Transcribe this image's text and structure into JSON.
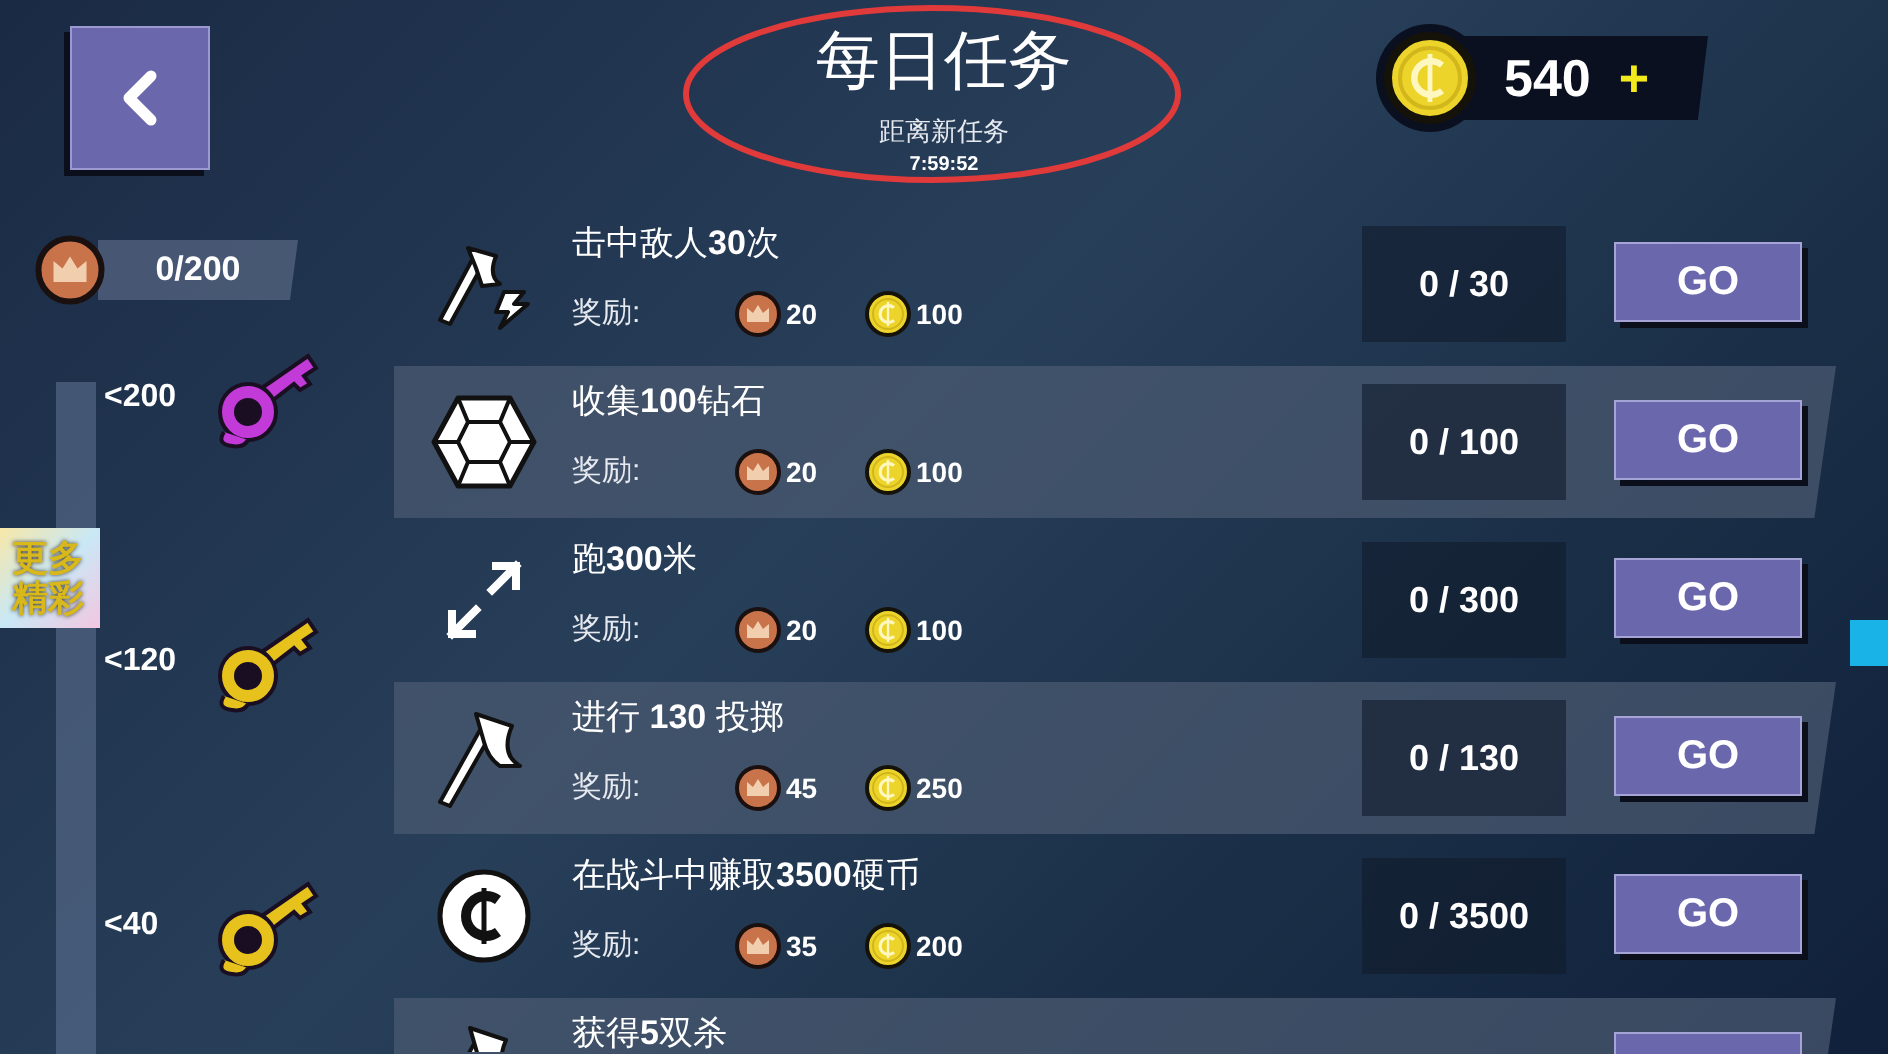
{
  "header": {
    "title": "每日任务",
    "subtitle": "距离新任务",
    "timer": "7:59:52"
  },
  "wallet": {
    "coins": "540",
    "add_label": "+"
  },
  "crown_progress": {
    "value": "0/200"
  },
  "milestones": [
    {
      "label": "<200",
      "color": "#c23ad8"
    },
    {
      "label": "<120",
      "color": "#e8c21c"
    },
    {
      "label": "<40",
      "color": "#e8c21c"
    }
  ],
  "promo_badge": {
    "text": "更多精彩"
  },
  "tasks": [
    {
      "kind": "hit",
      "title": "击中敌人**30**次",
      "reward_label": "奖励:",
      "crowns": "20",
      "coins": "100",
      "progress": "0 / 30",
      "button": "GO"
    },
    {
      "kind": "collect",
      "title": "收集**100**钻石",
      "reward_label": "奖励:",
      "crowns": "20",
      "coins": "100",
      "progress": "0 / 100",
      "button": "GO"
    },
    {
      "kind": "run",
      "title": "跑**300**米",
      "reward_label": "奖励:",
      "crowns": "20",
      "coins": "100",
      "progress": "0 / 300",
      "button": "GO"
    },
    {
      "kind": "throw",
      "title": "进行 **130** 投掷",
      "reward_label": "奖励:",
      "crowns": "45",
      "coins": "250",
      "progress": "0 / 130",
      "button": "GO"
    },
    {
      "kind": "earn",
      "title": "在战斗中赚取**3500**硬币",
      "reward_label": "奖励:",
      "crowns": "35",
      "coins": "200",
      "progress": "0 / 3500",
      "button": "GO"
    },
    {
      "kind": "throw",
      "title": "获得**5**双杀"
    }
  ]
}
